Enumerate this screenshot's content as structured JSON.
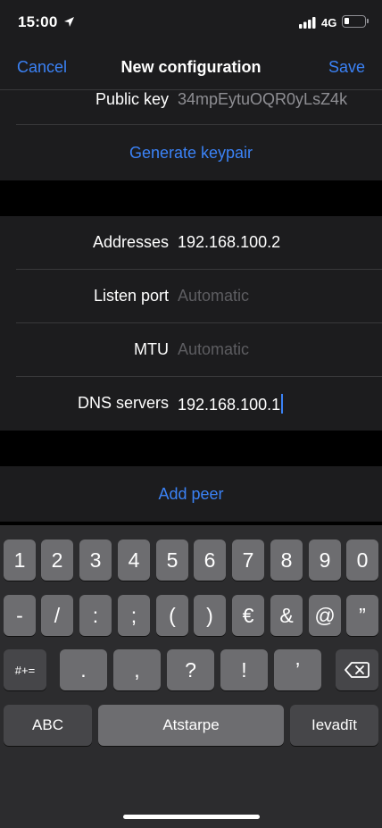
{
  "status_bar": {
    "time": "15:00",
    "network": "4G"
  },
  "nav": {
    "cancel_label": "Cancel",
    "title": "New configuration",
    "save_label": "Save"
  },
  "interface_section": {
    "public_key_label": "Public key",
    "public_key_value": "34mpEytuOQR0yLsZ4k",
    "generate_keypair_label": "Generate keypair"
  },
  "network_section": {
    "rows": [
      {
        "label": "Addresses",
        "value": "192.168.100.2",
        "placeholder": ""
      },
      {
        "label": "Listen port",
        "value": "",
        "placeholder": "Automatic"
      },
      {
        "label": "MTU",
        "value": "",
        "placeholder": "Automatic"
      },
      {
        "label": "DNS servers",
        "value": "192.168.100.1",
        "placeholder": ""
      }
    ]
  },
  "peer_section": {
    "add_peer_label": "Add peer"
  },
  "keyboard": {
    "row1": [
      "1",
      "2",
      "3",
      "4",
      "5",
      "6",
      "7",
      "8",
      "9",
      "0"
    ],
    "row2": [
      "-",
      "/",
      ":",
      ";",
      "(",
      ")",
      "€",
      "&",
      "@",
      "”"
    ],
    "row3": [
      "#+=",
      ".",
      ",",
      "?",
      "!",
      "’"
    ],
    "abc_label": "ABC",
    "space_label": "Atstarpe",
    "return_label": "Ievadīt"
  },
  "colors": {
    "accent": "#3b82f6",
    "background": "#000000",
    "cell": "#1c1c1e"
  }
}
